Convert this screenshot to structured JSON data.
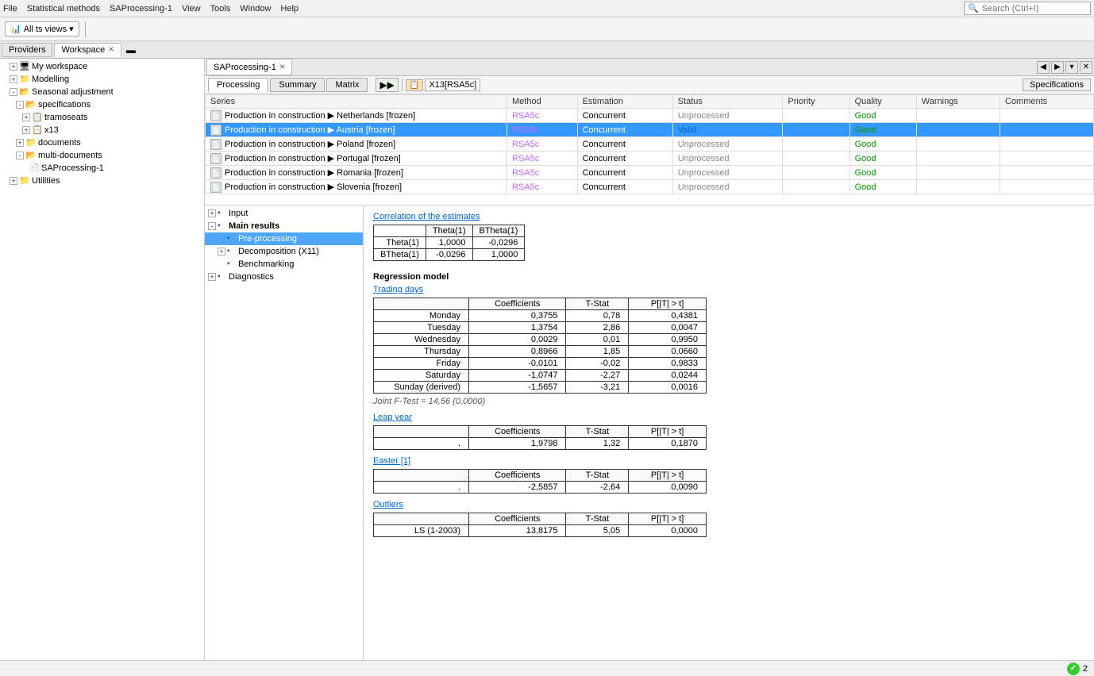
{
  "menubar": {
    "items": [
      "File",
      "Statistical methods",
      "SAProcessing-1",
      "View",
      "Tools",
      "Window",
      "Help"
    ],
    "search_placeholder": "Search (Ctrl+I)"
  },
  "toolbar": {
    "dropdown_label": "All ts views",
    "icons": [
      "grid-icon",
      "chart-icon"
    ]
  },
  "panel_tabs": {
    "tabs": [
      {
        "label": "Providers",
        "active": false
      },
      {
        "label": "Workspace",
        "active": true,
        "closable": true
      }
    ],
    "minimize_icon": "_"
  },
  "tree": {
    "items": [
      {
        "label": "My workspace",
        "indent": 0,
        "icon": "folder",
        "expandable": false
      },
      {
        "label": "Modelling",
        "indent": 1,
        "icon": "folder",
        "expandable": true,
        "expanded": false
      },
      {
        "label": "Seasonal adjustment",
        "indent": 1,
        "icon": "folder",
        "expandable": true,
        "expanded": true
      },
      {
        "label": "specifications",
        "indent": 2,
        "icon": "folder",
        "expandable": true,
        "expanded": true
      },
      {
        "label": "tramoseats",
        "indent": 3,
        "icon": "item",
        "expandable": true,
        "expanded": false
      },
      {
        "label": "x13",
        "indent": 3,
        "icon": "item",
        "expandable": true,
        "expanded": false
      },
      {
        "label": "documents",
        "indent": 2,
        "icon": "folder",
        "expandable": true,
        "expanded": false
      },
      {
        "label": "multi-documents",
        "indent": 2,
        "icon": "folder",
        "expandable": true,
        "expanded": true
      },
      {
        "label": "SAProcessing-1",
        "indent": 3,
        "icon": "doc",
        "expandable": false
      },
      {
        "label": "Utilities",
        "indent": 1,
        "icon": "folder",
        "expandable": true,
        "expanded": false
      }
    ]
  },
  "doc_tabs": {
    "tabs": [
      {
        "label": "SAProcessing-1",
        "active": true,
        "closable": true
      }
    ]
  },
  "content_tabs": {
    "tabs": [
      {
        "label": "Processing",
        "active": true
      },
      {
        "label": "Summary",
        "active": false
      },
      {
        "label": "Matrix",
        "active": false
      }
    ],
    "toolbar_items": [
      "icon1",
      "icon2",
      "x13_rsa5c"
    ],
    "x13_label": "X13[RSA5c]",
    "spec_button": "Specifications"
  },
  "series_table": {
    "headers": [
      "Series",
      "Method",
      "Estimation",
      "Status",
      "Priority",
      "Quality",
      "Warnings",
      "Comments"
    ],
    "rows": [
      {
        "series": "Production in construction ▶ Netherlands [frozen]",
        "method": "RSA5c",
        "estimation": "Concurrent",
        "status": "Unprocessed",
        "priority": "",
        "quality": "Good",
        "warnings": "",
        "comments": "",
        "selected": false
      },
      {
        "series": "Production in construction ▶ Austria [frozen]",
        "method": "RSA5c",
        "estimation": "Concurrent",
        "status": "Valid",
        "priority": "",
        "quality": "Good",
        "warnings": "",
        "comments": "",
        "selected": true
      },
      {
        "series": "Production in construction ▶ Poland [frozen]",
        "method": "RSA5c",
        "estimation": "Concurrent",
        "status": "Unprocessed",
        "priority": "",
        "quality": "Good",
        "warnings": "",
        "comments": "",
        "selected": false
      },
      {
        "series": "Production in construction ▶ Portugal [frozen]",
        "method": "RSA5c",
        "estimation": "Concurrent",
        "status": "Unprocessed",
        "priority": "",
        "quality": "Good",
        "warnings": "",
        "comments": "",
        "selected": false
      },
      {
        "series": "Production in construction ▶ Romania [frozen]",
        "method": "RSA5c",
        "estimation": "Concurrent",
        "status": "Unprocessed",
        "priority": "",
        "quality": "Good",
        "warnings": "",
        "comments": "",
        "selected": false
      },
      {
        "series": "Production in construction ▶ Slovenia [frozen]",
        "method": "RSA5c",
        "estimation": "Concurrent",
        "status": "Unprocessed",
        "priority": "",
        "quality": "Good",
        "warnings": "",
        "comments": "",
        "selected": false
      }
    ]
  },
  "results_tree": {
    "items": [
      {
        "label": "Input",
        "indent": 0,
        "expandable": true,
        "expanded": false,
        "selected": false
      },
      {
        "label": "Main results",
        "indent": 0,
        "expandable": true,
        "expanded": true,
        "selected": false,
        "bold": true
      },
      {
        "label": "Pre-processing",
        "indent": 1,
        "expandable": false,
        "selected": true
      },
      {
        "label": "Decomposition (X11)",
        "indent": 1,
        "expandable": true,
        "expanded": false,
        "selected": false
      },
      {
        "label": "Benchmarking",
        "indent": 1,
        "expandable": false,
        "selected": false
      },
      {
        "label": "Diagnostics",
        "indent": 0,
        "expandable": true,
        "expanded": false,
        "selected": false
      }
    ]
  },
  "detail": {
    "correlation": {
      "title": "Correlation of the estimates",
      "headers": [
        "",
        "Theta(1)",
        "BTheta(1)"
      ],
      "rows": [
        {
          "label": "Theta(1)",
          "theta": "1,0000",
          "btheta": "-0,0296"
        },
        {
          "label": "BTheta(1)",
          "theta": "-0,0296",
          "btheta": "1,0000"
        }
      ]
    },
    "regression": {
      "title": "Regression model",
      "trading_days": {
        "subtitle": "Trading days",
        "headers": [
          "",
          "Coefficients",
          "T-Stat",
          "P[|T| > t]"
        ],
        "rows": [
          {
            "label": "Monday",
            "coeff": "0,3755",
            "tstat": "0,78",
            "p": "0,4381"
          },
          {
            "label": "Tuesday",
            "coeff": "1,3754",
            "tstat": "2,86",
            "p": "0,0047"
          },
          {
            "label": "Wednesday",
            "coeff": "0,0029",
            "tstat": "0,01",
            "p": "0,9950"
          },
          {
            "label": "Thursday",
            "coeff": "0,8966",
            "tstat": "1,85",
            "p": "0,0660"
          },
          {
            "label": "Friday",
            "coeff": "-0,0101",
            "tstat": "-0,02",
            "p": "0,9833"
          },
          {
            "label": "Saturday",
            "coeff": "-1,0747",
            "tstat": "-2,27",
            "p": "0,0244"
          },
          {
            "label": "Sunday (derived)",
            "coeff": "-1,5657",
            "tstat": "-3,21",
            "p": "0,0016"
          }
        ],
        "joint_f": "Joint F-Test = 14,56 (0,0000)"
      },
      "leap_year": {
        "subtitle": "Leap year",
        "headers": [
          "",
          "Coefficients",
          "T-Stat",
          "P[|T| > t]"
        ],
        "rows": [
          {
            "label": ".",
            "coeff": "1,9798",
            "tstat": "1,32",
            "p": "0,1870"
          }
        ]
      },
      "easter": {
        "subtitle": "Easter [1]",
        "headers": [
          "",
          "Coefficients",
          "T-Stat",
          "P[|T| > t]"
        ],
        "rows": [
          {
            "label": ".",
            "coeff": "-2,5857",
            "tstat": "-2,64",
            "p": "0,0090"
          }
        ]
      },
      "outliers": {
        "subtitle": "Outliers",
        "headers": [
          "",
          "Coefficients",
          "T-Stat",
          "P[|T| > t]"
        ],
        "rows": [
          {
            "label": "LS (1-2003)",
            "coeff": "13,8175",
            "tstat": "5,05",
            "p": "0,0000"
          }
        ]
      }
    }
  },
  "status_bar": {
    "count": "2",
    "ok_label": "✓"
  }
}
